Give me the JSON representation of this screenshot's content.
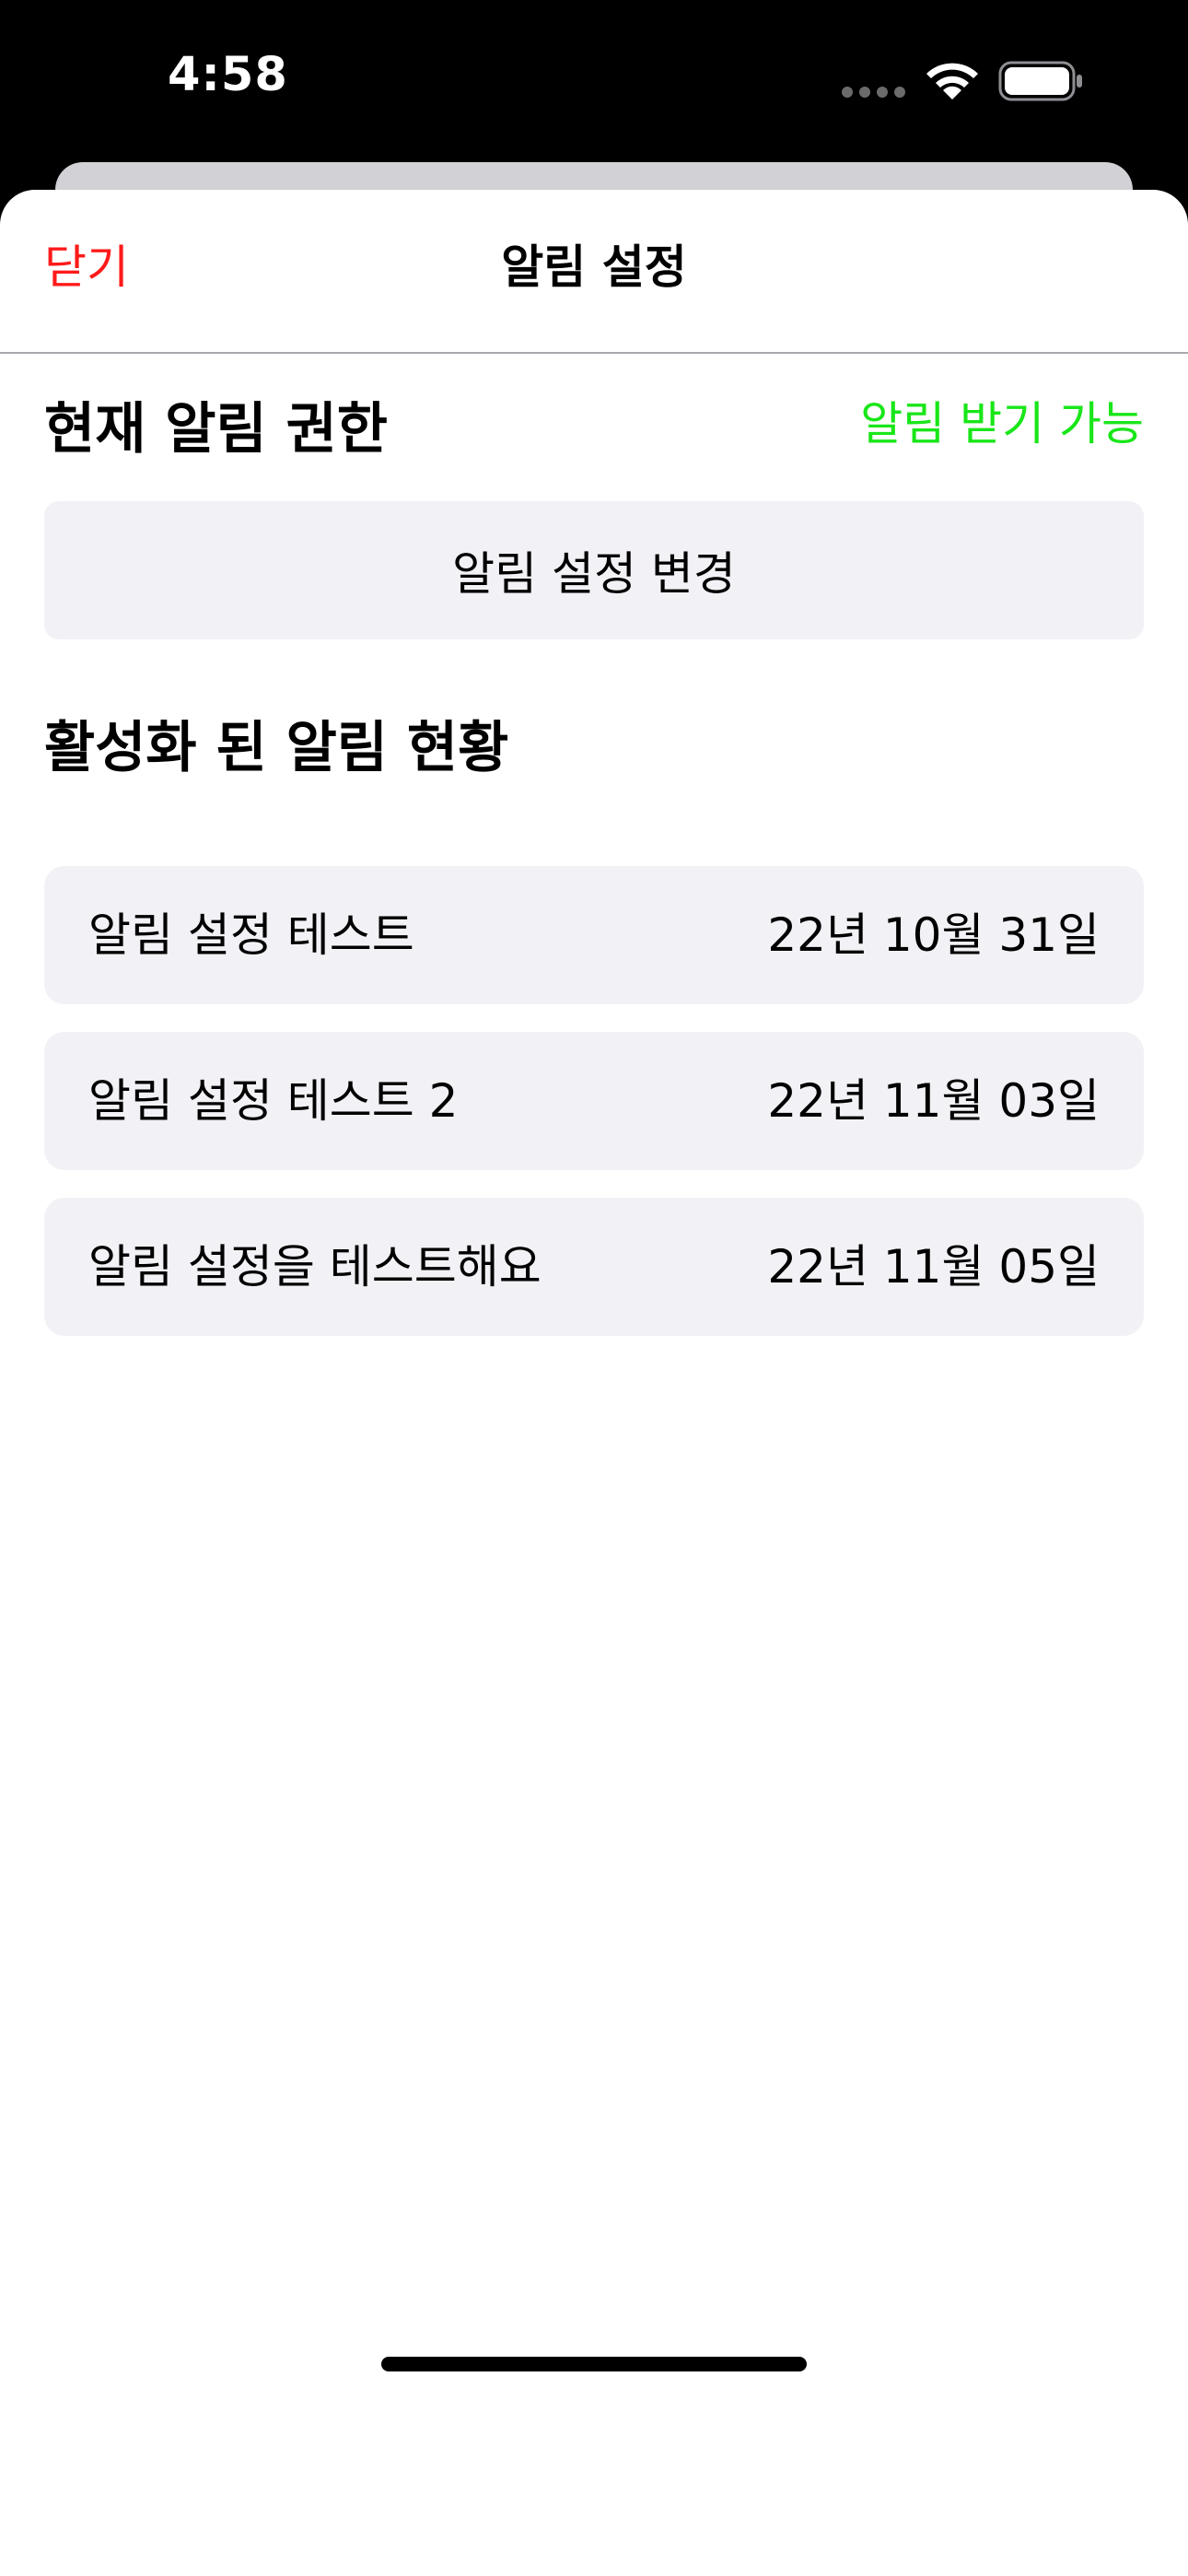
{
  "status_bar": {
    "time": "4:58"
  },
  "nav": {
    "close_label": "닫기",
    "title": "알림 설정"
  },
  "permission": {
    "header": "현재 알림 권한",
    "status": "알림 받기 가능",
    "status_color": "#19e619",
    "change_button_label": "알림 설정 변경"
  },
  "active_alarms": {
    "header": "활성화 된 알림 현황",
    "items": [
      {
        "title": "알림 설정 테스트",
        "date": "22년 10월 31일"
      },
      {
        "title": "알림 설정 테스트 2",
        "date": "22년 11월 03일"
      },
      {
        "title": "알림 설정을 테스트해요",
        "date": "22년 11월 05일"
      }
    ]
  },
  "colors": {
    "close_red": "#ff1a1a",
    "card_background": "#f2f2f6"
  },
  "icons": [
    "wifi-icon",
    "battery-icon"
  ]
}
